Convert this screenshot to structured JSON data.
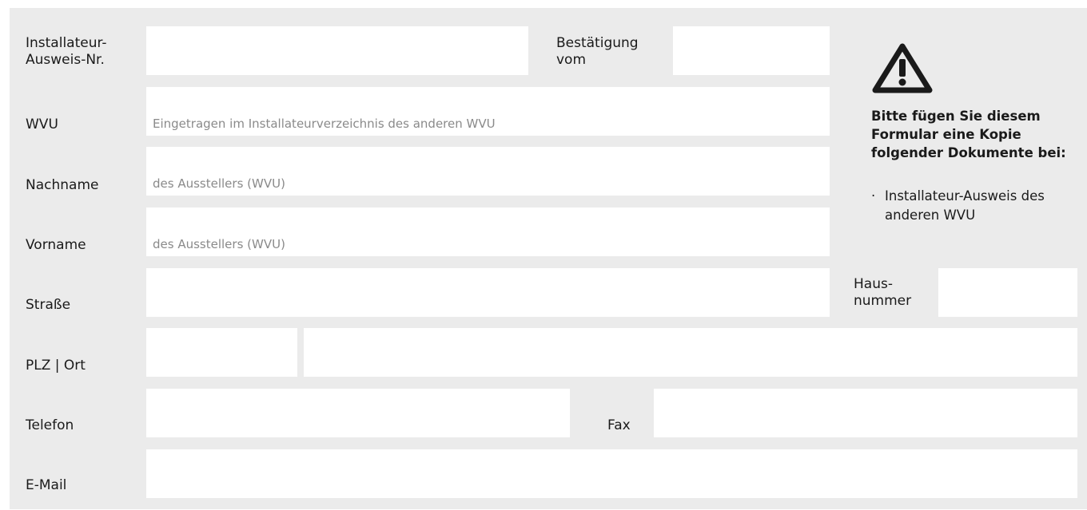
{
  "colors": {
    "panel": "#ebebeb",
    "field": "#ffffff",
    "text": "#1a1a1a",
    "placeholder": "#8a8a8a"
  },
  "labels": {
    "ausweis_line1": "Installateur-",
    "ausweis_line2": "Ausweis-Nr.",
    "bestaetigung_line1": "Bestätigung",
    "bestaetigung_line2": "vom",
    "wvu": "WVU",
    "nachname": "Nachname",
    "vorname": "Vorname",
    "strasse": "Straße",
    "hausnummer_line1": "Haus-",
    "hausnummer_line2": "nummer",
    "plz_ort": "PLZ | Ort",
    "telefon": "Telefon",
    "fax": "Fax",
    "email": "E-Mail"
  },
  "fields": {
    "ausweis": {
      "value": "",
      "placeholder": ""
    },
    "bestaetigung": {
      "value": "",
      "placeholder": ""
    },
    "wvu": {
      "value": "",
      "placeholder": "Eingetragen im Installateurverzeichnis des anderen WVU"
    },
    "nachname": {
      "value": "",
      "placeholder": "des Ausstellers (WVU)"
    },
    "vorname": {
      "value": "",
      "placeholder": "des Ausstellers (WVU)"
    },
    "strasse": {
      "value": "",
      "placeholder": ""
    },
    "hausnummer": {
      "value": "",
      "placeholder": ""
    },
    "plz": {
      "value": "",
      "placeholder": ""
    },
    "ort": {
      "value": "",
      "placeholder": ""
    },
    "telefon": {
      "value": "",
      "placeholder": ""
    },
    "fax": {
      "value": "",
      "placeholder": ""
    },
    "email": {
      "value": "",
      "placeholder": ""
    }
  },
  "notice": {
    "icon": "warning-icon",
    "title": "Bitte fügen Sie diesem Formular eine Kopie folgender Dokumente bei:",
    "bullet": "·",
    "items": [
      "Installateur-Ausweis des anderen WVU"
    ]
  }
}
